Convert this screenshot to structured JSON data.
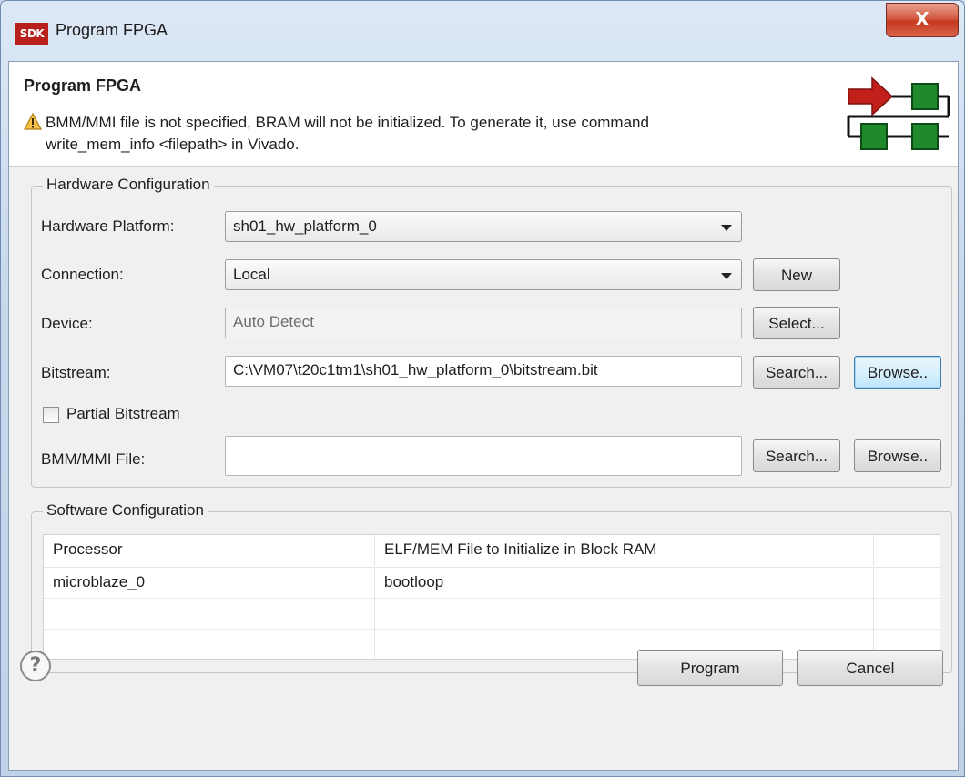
{
  "window": {
    "app_icon_text": "SDK",
    "title": "Program FPGA",
    "close_glyph": "X"
  },
  "banner": {
    "title": "Program FPGA",
    "warning_line1": "BMM/MMI file is not specified, BRAM will not be initialized. To generate it, use command",
    "warning_line2": "write_mem_info <filepath> in Vivado.",
    "icons": [
      "warning-icon",
      "program-fpga-graphic"
    ]
  },
  "hardware": {
    "group_label": "Hardware Configuration",
    "platform_label": "Hardware Platform:",
    "platform_value": "sh01_hw_platform_0",
    "connection_label": "Connection:",
    "connection_value": "Local",
    "new_button": "New",
    "device_label": "Device:",
    "device_value": "Auto Detect",
    "select_button": "Select...",
    "bitstream_label": "Bitstream:",
    "bitstream_value": "C:\\VM07\\t20c1tm1\\sh01_hw_platform_0\\bitstream.bit",
    "search_button": "Search...",
    "browse_button": "Browse..",
    "partial_label": "Partial Bitstream",
    "partial_checked": false,
    "bmm_label": "BMM/MMI File:",
    "bmm_value": "",
    "bmm_search_button": "Search...",
    "bmm_browse_button": "Browse.."
  },
  "software": {
    "group_label": "Software Configuration",
    "columns": [
      "Processor",
      "ELF/MEM File to Initialize in Block RAM"
    ],
    "rows": [
      [
        "microblaze_0",
        "bootloop"
      ]
    ]
  },
  "footer": {
    "help_glyph": "?",
    "program_button": "Program",
    "cancel_button": "Cancel"
  },
  "colors": {
    "close_red": "#c5381f",
    "arrow_red": "#c21f1a",
    "block_green": "#1f8a2b",
    "focus_blue": "#3c7fb1"
  }
}
